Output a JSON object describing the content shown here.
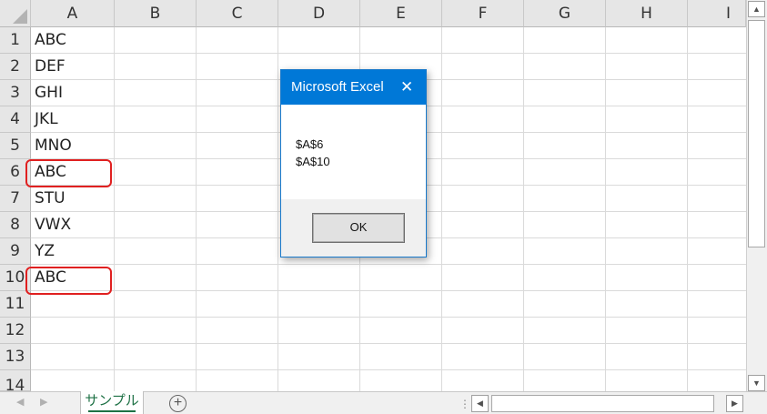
{
  "columns": [
    "A",
    "B",
    "C",
    "D",
    "E",
    "F",
    "G",
    "H",
    "I"
  ],
  "rows": [
    "1",
    "2",
    "3",
    "4",
    "5",
    "6",
    "7",
    "8",
    "9",
    "10",
    "11",
    "12",
    "13",
    "14"
  ],
  "cells_a": [
    "ABC",
    "DEF",
    "GHI",
    "JKL",
    "MNO",
    "ABC",
    "STU",
    "VWX",
    "YZ",
    "ABC"
  ],
  "highlighted_rows": [
    6,
    10
  ],
  "highlight_color": "#e02020",
  "sheet_tab": "サンプル",
  "add_sheet_symbol": "+",
  "dialog": {
    "title": "Microsoft Excel",
    "close_symbol": "✕",
    "message_lines": [
      "$A$6",
      "$A$10"
    ],
    "ok_label": "OK"
  },
  "accent_color": "#0078d7"
}
